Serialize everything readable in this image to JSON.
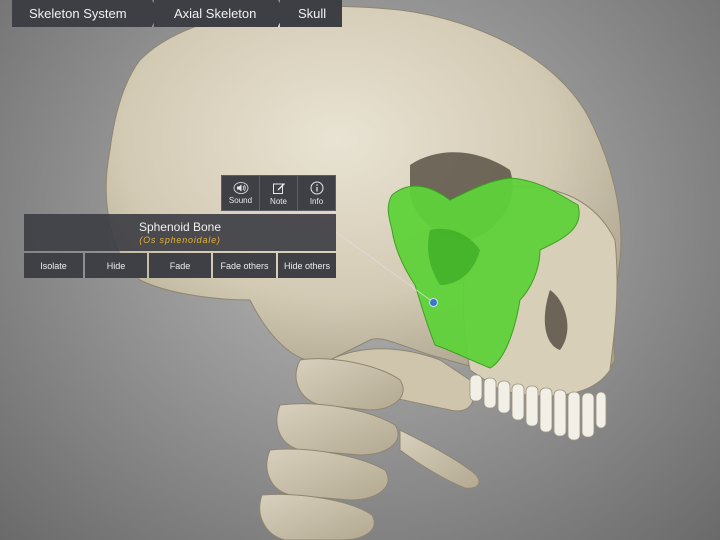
{
  "breadcrumb": {
    "items": [
      "Skeleton System",
      "Axial Skeleton",
      "Skull"
    ]
  },
  "toolbar": {
    "sound_label": "Sound",
    "note_label": "Note",
    "info_label": "Info"
  },
  "selection": {
    "name": "Sphenoid Bone",
    "latin": "(Os sphenoidale)"
  },
  "actions": {
    "isolate": "Isolate",
    "hide": "Hide",
    "fade": "Fade",
    "fade_others": "Fade others",
    "hide_others": "Hide others"
  },
  "colors": {
    "panel": "#3e3f45",
    "highlight": "#5fd23a",
    "latin_text": "#e2b23c",
    "bone": "#d9d1bd"
  },
  "icons": {
    "sound": "speaker-icon",
    "note": "note-edit-icon",
    "info": "info-icon",
    "pin": "location-pin-icon"
  }
}
